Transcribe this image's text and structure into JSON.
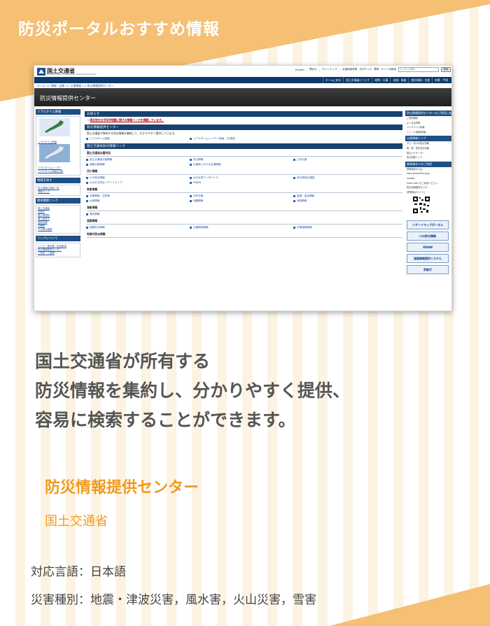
{
  "header": {
    "title": "防災ポータルおすすめ情報"
  },
  "colors": {
    "accent": "#f29a1c",
    "banner": "#f5bf74",
    "stripe": "#fdf3e3",
    "text": "#555555"
  },
  "screenshot": {
    "logo": {
      "name": "国土交通省",
      "sub": "Ministry of Land, Infrastructure, Transport and Tourism"
    },
    "utility_links": [
      "English",
      "問合せ",
      "サイトマップ",
      "災害時救済策",
      "文字サイズ",
      "標準",
      "サイト内検索"
    ],
    "search": {
      "placeholder": "カスタム検索",
      "button": "検索"
    },
    "nav": [
      "ホームに戻る",
      "国土交通省について",
      "政策・仕事",
      "広報・報道",
      "統計情報・白書",
      "申請・手続"
    ],
    "breadcrumb": "ホーム >> 情報・広報 >> 災害情報 >> 防災情報提供センター",
    "banner_title": "防災情報提供センター",
    "left": {
      "realtime_head": "リアルタイム情報",
      "realtime_links": [
        "リアルタイム雨量",
        "リアルタイムレーダー",
        "リアルタイム雨量(広域)"
      ],
      "search_head": "情報を探す",
      "search_links": [
        "防災情報の検索一覧",
        "情報マップ"
      ],
      "links_head": "関係機関リンク",
      "links": [
        "国土交通省",
        "気象庁",
        "国土地理院",
        "海上保安庁",
        "政府広報",
        "内閣府",
        "その他の機関"
      ],
      "about_head": "リンクについて",
      "about_links": [
        "リンク・著作権・免責事項",
        "防災情報提供センター",
        "ご意見・ご感想"
      ]
    },
    "main": {
      "notice_head": "お知らせ",
      "notice_text": "東北地方太平洋沖地震に関する情報リンクを掲載しています。",
      "center_head": "防災情報提供センター",
      "center_text": "国土交通省が保有する防災情報を集約して、わかりやすく提供しています。",
      "center_links": [
        "リアルタイム雨量",
        "リアルタイムレーダー(雨量・広域版)"
      ],
      "mlit_head": "国土交通省防災情報リンク",
      "groups": [
        {
          "title": "国土交通省災害対応",
          "items": [
            "国土交通省災害情報",
            "防災情報",
            "土砂災害",
            "道路災害情報",
            "災害時における交通情報"
          ]
        },
        {
          "title": "河川情報",
          "items": [
            "川の防災情報",
            "水文水質データベース",
            "浸水想定区域図",
            "わがまち防災ハザードマップ",
            "XRAIN"
          ]
        },
        {
          "title": "気象情報",
          "items": [
            "気象警報・注意報",
            "天気予報",
            "高潮・高波情報",
            "台風情報",
            "地震情報",
            "津波情報"
          ]
        },
        {
          "title": "海象情報",
          "items": [
            "潮位情報"
          ]
        },
        {
          "title": "道路情報",
          "items": [
            "道路防災情報",
            "交通規制情報",
            "冬期道路情報"
          ]
        },
        {
          "title": "地域の防災情報",
          "items": []
        }
      ]
    },
    "right": {
      "head1": "防災情報提供センターのご利用にあたって",
      "list1": [
        "ご利用規約",
        "よくある質問",
        "メンテナンス情報",
        "ニュース(新着情報)"
      ],
      "head2": "災害情報リンク",
      "list2": [
        "ダム・河川の防災情報",
        "雨・雪・風を知る情報",
        "防災ナビゲーター",
        "防災関連リンク"
      ],
      "head3": "携帯端末でのご利用",
      "list3": [
        "携帯端末からは、",
        "http://www.mlit.go.jp",
        "/saigai/",
        "index.html をご利用ください。",
        "防災情報提供センター",
        "(携帯版QRコード)"
      ],
      "banners": [
        "ハザードマップポータル",
        "川の防災情報",
        "XRAIN",
        "道路情報提供システム",
        "気象庁"
      ]
    }
  },
  "description": [
    "国土交通省が所有する",
    "防災情報を集約し、分かりやすく提供、",
    "容易に検索することができます。"
  ],
  "service": {
    "name": "防災情報提供センター",
    "org": "国土交通省"
  },
  "meta": {
    "language": "対応言語：日本語",
    "disaster_types": "災害種別：地震・津波災害，風水害，火山災害，雪害"
  }
}
